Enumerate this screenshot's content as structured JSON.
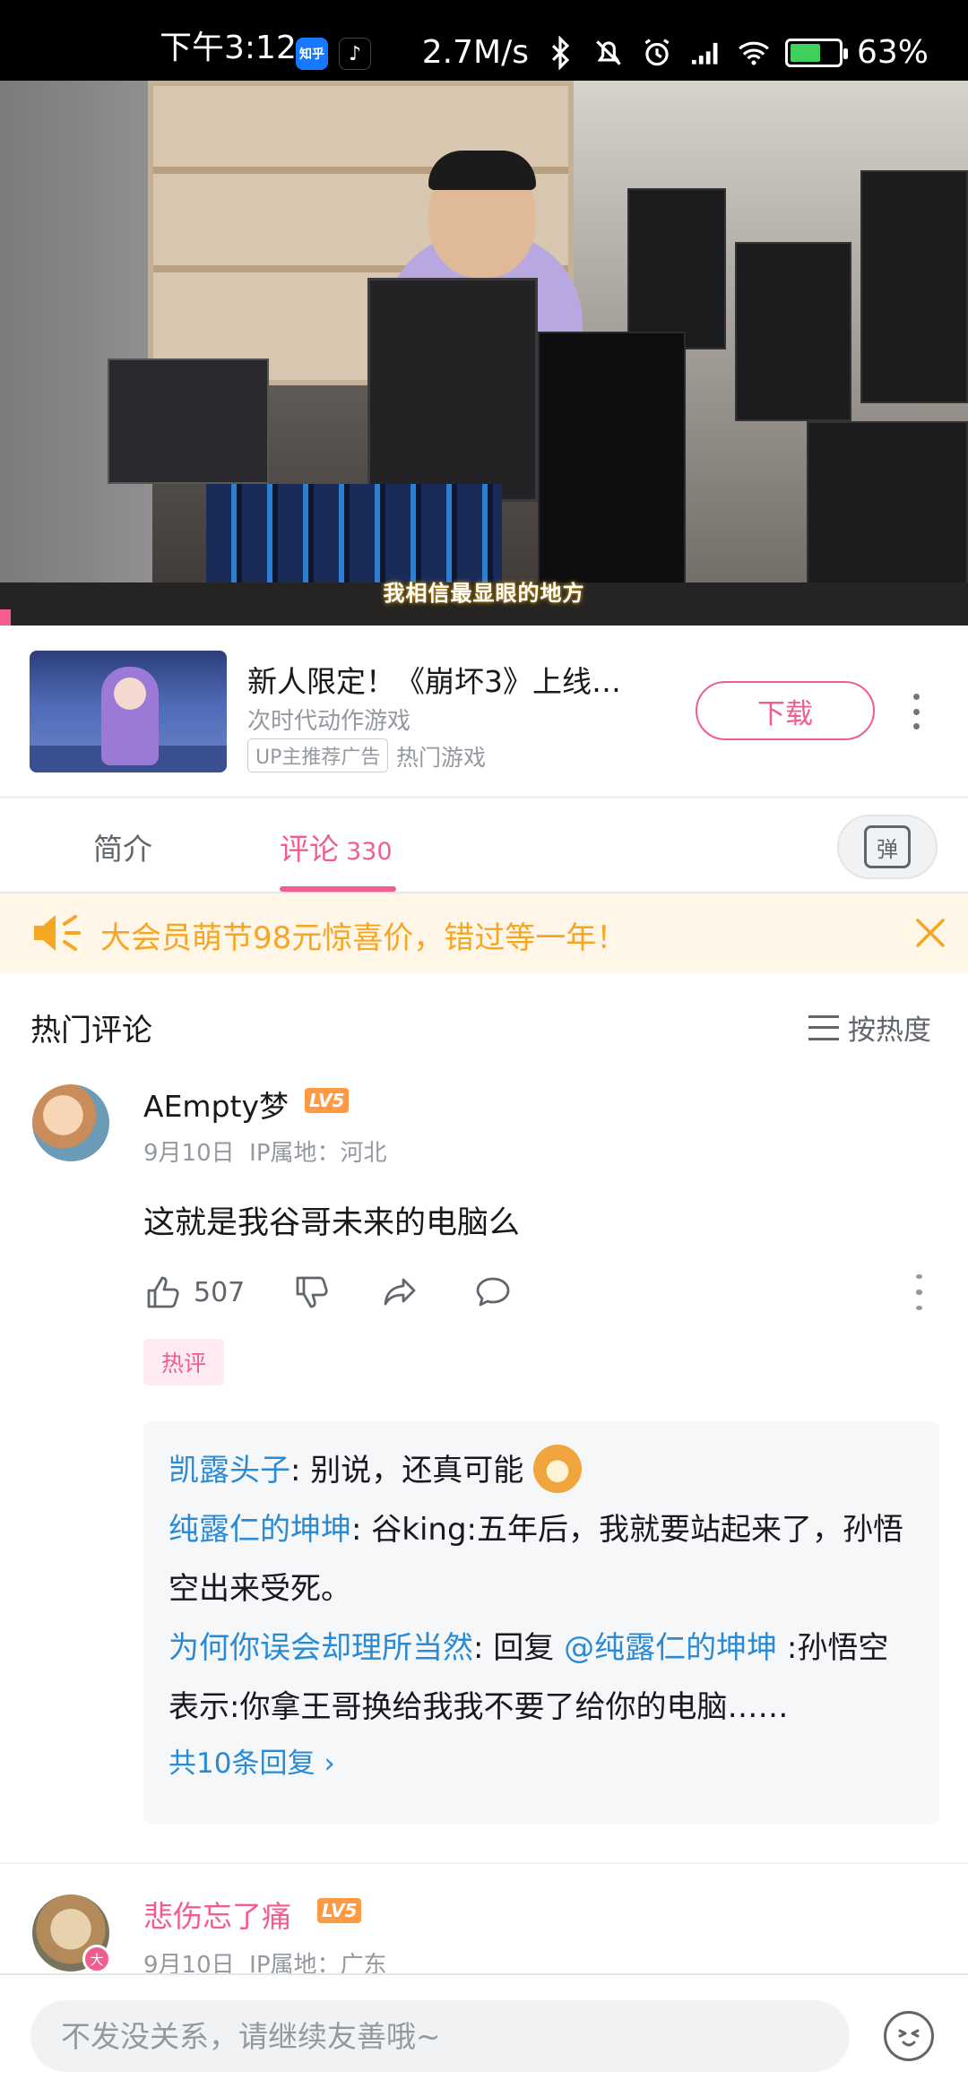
{
  "status_bar": {
    "time": "下午3:12",
    "app1_label": "知乎",
    "network_speed": "2.7M/s",
    "battery": "63%",
    "battery_level": 0.63
  },
  "video": {
    "subtitle": "我相信最显眼的地方"
  },
  "ad": {
    "title": "新人限定！《崩坏3》上线…",
    "subtitle": "次时代动作游戏",
    "tag": "UP主推荐广告",
    "category": "热门游戏",
    "button_label": "下载"
  },
  "tabs": {
    "intro": "简介",
    "comments": "评论",
    "comment_count": "330",
    "danmaku_label": "弹"
  },
  "promo": {
    "text": "大会员萌节98元惊喜价，错过等一年！",
    "accent": "#f5a623"
  },
  "comments_section": {
    "title": "热门评论",
    "sort_label": "按热度"
  },
  "comments": [
    {
      "user": "AEmpty梦",
      "level": "LV5",
      "date": "9月10日",
      "ip": "IP属地：河北",
      "text": "这就是我谷哥未来的电脑么",
      "likes": "507",
      "tag": "热评",
      "replies": [
        {
          "user": "凯露头子",
          "sep": ": ",
          "text": "别说，还真可能"
        },
        {
          "user": "纯露仁的坤坤",
          "sep": ": ",
          "text": "谷king:五年后，我就要站起来了，孙悟空出来受死。"
        },
        {
          "user": "为何你误会却理所当然",
          "sep": ": ",
          "prefix": "回复 ",
          "mention": "@纯露仁的坤坤",
          "text": " :孙悟空表示:你拿王哥换给我我不要了给你的电脑……"
        }
      ],
      "more_replies": "共10条回复"
    },
    {
      "user": "悲伤忘了痛",
      "level": "LV5",
      "date": "9月10日",
      "ip": "IP属地：广东",
      "avatar_badge": "大"
    }
  ],
  "input": {
    "placeholder": "不发没关系，请继续友善哦~"
  },
  "colors": {
    "brand_pink": "#f25d8e",
    "link_blue": "#2a8ad4",
    "level_orange": "#ff9a44"
  }
}
